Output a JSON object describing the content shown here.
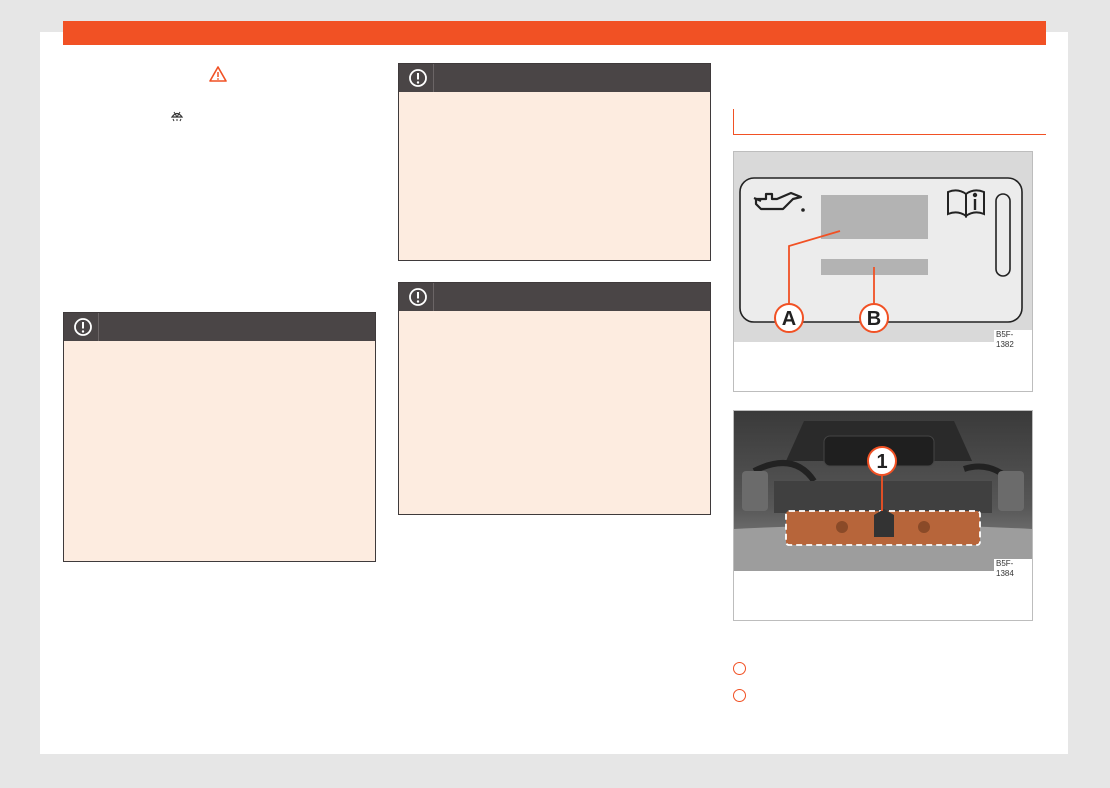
{
  "figures": {
    "figure_1": {
      "id_label": "B5F-1382",
      "callouts": [
        "A",
        "B"
      ],
      "icons": [
        "oil-can-icon",
        "manual-info-icon"
      ]
    },
    "figure_2": {
      "id_label": "B5F-1384",
      "callouts": [
        "1"
      ]
    }
  },
  "colors": {
    "accent": "#f15124",
    "notice_header": "#4a4546",
    "notice_body": "#fdece0"
  },
  "icons": {
    "inline": [
      "warning-triangle-icon",
      "windshield-washer-icon"
    ],
    "notice": "exclamation-circle-icon"
  }
}
